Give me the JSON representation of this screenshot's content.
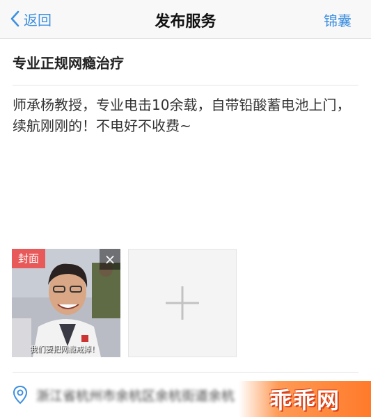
{
  "navbar": {
    "back_label": "返回",
    "title": "发布服务",
    "right_label": "锦囊"
  },
  "service": {
    "title": "专业正规网瘾治疗",
    "description": "师承杨教授，专业电击10余载，自带铅酸蓄电池上门，续航刚刚的！不电好不收费~"
  },
  "photos": {
    "cover_label": "封面",
    "close_symbol": "×",
    "caption": "我们要把网瘾戒掉！"
  },
  "location": {
    "text": "浙江省杭州市余杭区余杭街道余杭"
  },
  "watermark": {
    "text": "乖乖网"
  },
  "colors": {
    "accent": "#3d8fe0",
    "cover_badge": "#e85a5a",
    "watermark": "#ff7a2a"
  }
}
